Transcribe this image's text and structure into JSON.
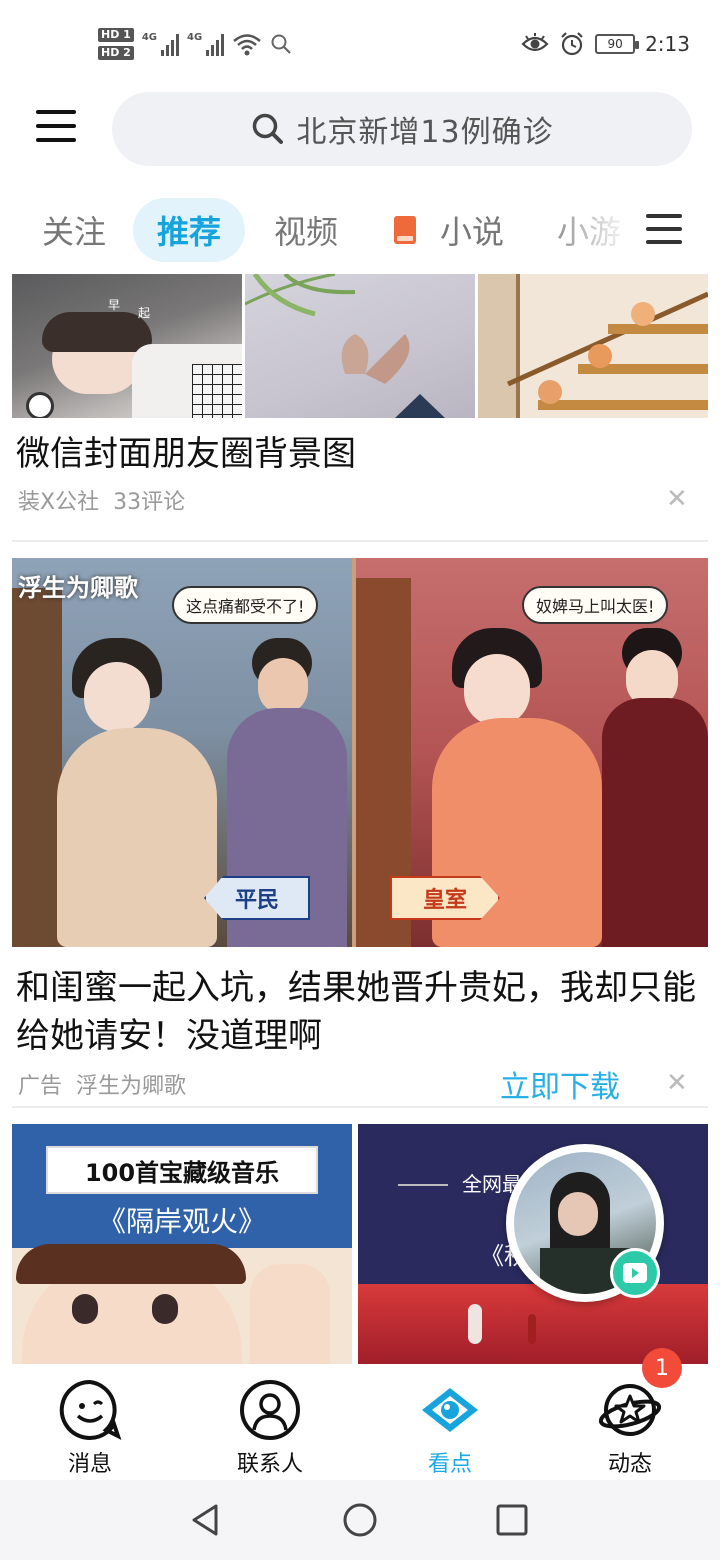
{
  "status_bar": {
    "sim1": "HD 1",
    "sim2": "HD 2",
    "network1": "4G",
    "network2": "4G",
    "battery": "90",
    "time": "2:13"
  },
  "header": {
    "search_text": "北京新增13例确诊"
  },
  "tabs": [
    {
      "label": "关注",
      "active": false
    },
    {
      "label": "推荐",
      "active": true
    },
    {
      "label": "视频",
      "active": false
    },
    {
      "label": "小说",
      "active": false
    },
    {
      "label": "小游",
      "active": false
    }
  ],
  "feed": {
    "post1": {
      "title": "微信封面朋友圈背景图",
      "source": "装X公社",
      "comments": "33评论",
      "image1_caption": [
        "早",
        "起"
      ]
    },
    "ad": {
      "logo_text": "浮生为卿歌",
      "bubble_left": "这点痛都受不了!",
      "bubble_right": "奴婢马上叫太医!",
      "sign_left": "平民",
      "sign_right": "皇室",
      "title": "和闺蜜一起入坑，结果她晋升贵妃，我却只能给她请安！没道理啊",
      "ad_label": "广告",
      "advertiser": "浮生为卿歌",
      "cta": "立即下载"
    },
    "post3": {
      "left_banner": "100首宝藏级音乐",
      "left_subtitle": "《隔岸观火》",
      "right_banner": "全网最",
      "right_subtitle": "《秋"
    }
  },
  "bottom_nav": [
    {
      "label": "消息",
      "icon": "message-smiley-icon"
    },
    {
      "label": "联系人",
      "icon": "contacts-icon"
    },
    {
      "label": "看点",
      "icon": "eye-icon",
      "active": true
    },
    {
      "label": "动态",
      "icon": "star-planet-icon"
    }
  ],
  "badge_count": "1",
  "colors": {
    "accent": "#17a4dd",
    "badge": "#f24b3a",
    "cta": "#28b0e6"
  }
}
